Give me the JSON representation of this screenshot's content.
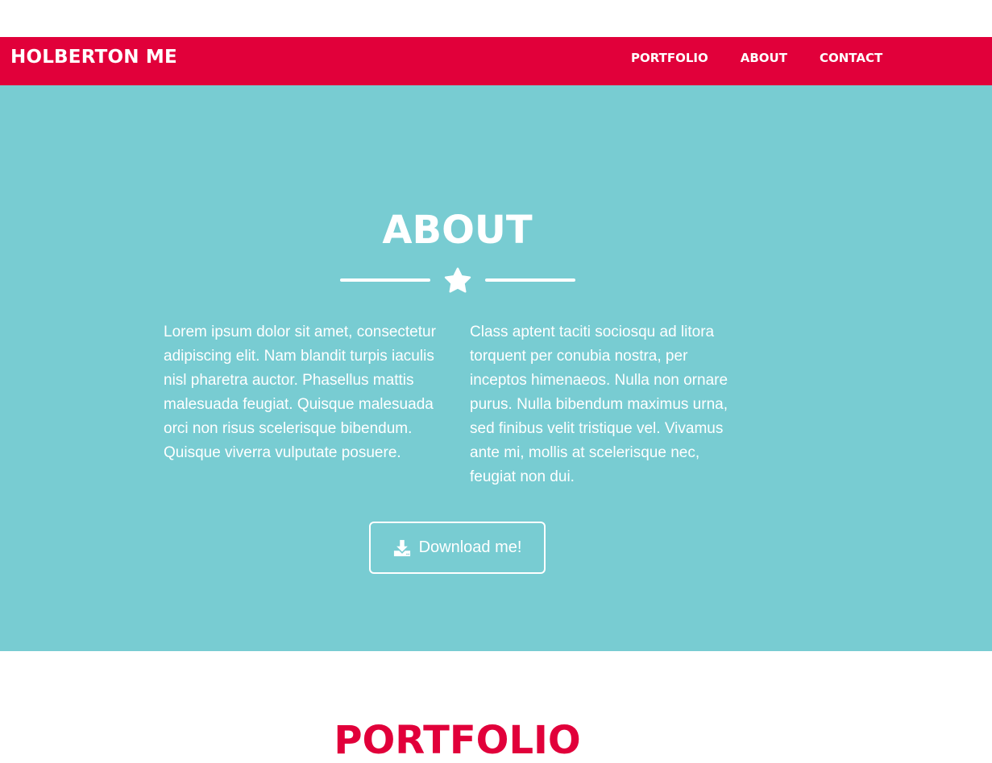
{
  "navbar": {
    "brand": "HOLBERTON ME",
    "links": [
      {
        "label": "PORTFOLIO"
      },
      {
        "label": "ABOUT"
      },
      {
        "label": "CONTACT"
      }
    ],
    "background": "#e1003a"
  },
  "about": {
    "title": "ABOUT",
    "divider_icon": "star-icon",
    "left_paragraph": "Lorem ipsum dolor sit amet, consectetur adipiscing elit. Nam blandit turpis iaculis nisl pharetra auctor. Phasellus mattis malesuada feugiat. Quisque malesuada orci non risus scelerisque bibendum. Quisque viverra vulputate posuere.",
    "right_paragraph": "Class aptent taciti sociosqu ad litora torquent per conubia nostra, per inceptos himenaeos. Nulla non ornare purus. Nulla bibendum maximus urna, sed finibus velit tristique vel. Vivamus ante mi, mollis at scelerisque nec, feugiat non dui.",
    "download_button": {
      "label": "Download me!",
      "icon": "download-icon"
    },
    "background": "#78ccd2"
  },
  "portfolio": {
    "title": "PORTFOLIO"
  }
}
